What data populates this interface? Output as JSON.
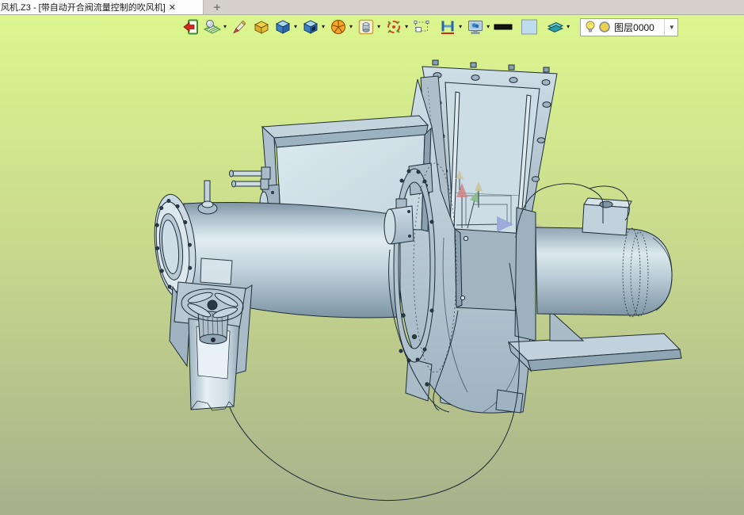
{
  "window": {
    "tab_title": "风机.Z3 - [带自动开合阀流量控制的吹风机]",
    "close_glyph": "✕",
    "new_tab_glyph": "+"
  },
  "toolbar": {
    "dropdown_glyph": "▾",
    "combo_dropdown_glyph": "▼",
    "icons": [
      {
        "name": "exit-icon",
        "dropdown": false
      },
      {
        "name": "datum-plane-icon",
        "dropdown": true
      },
      {
        "name": "sketch-pen-icon",
        "dropdown": false
      },
      {
        "name": "extrude-block-icon",
        "dropdown": false
      },
      {
        "name": "solid-box-icon",
        "dropdown": true
      },
      {
        "name": "box-hole-icon",
        "dropdown": true
      },
      {
        "name": "revolve-sphere-icon",
        "dropdown": true
      },
      {
        "name": "cylinder-frame-icon",
        "dropdown": true
      },
      {
        "name": "point-target-icon",
        "dropdown": true
      },
      {
        "name": "selection-box-icon",
        "dropdown": false
      },
      {
        "name": "dimension-icon",
        "dropdown": true
      },
      {
        "name": "display-mode-icon",
        "dropdown": true
      },
      {
        "name": "line-width-swatch",
        "dropdown": false
      },
      {
        "name": "color-swatch",
        "dropdown": false
      },
      {
        "name": "layers-icon",
        "dropdown": true
      }
    ],
    "layer_combo": {
      "value": "图层0000",
      "bulb_icon": "layer-visibility-bulb",
      "color_icon": "layer-color-circle"
    }
  },
  "viewport": {
    "model_name": "带自动开合阀流量控制的吹风机",
    "background_gradient_top": "#dcf68e",
    "background_gradient_bottom": "#a7b18c",
    "model_fill": "#b9c9d5",
    "model_outline": "#1e2d38",
    "triad_colors": {
      "x": "#cc8484",
      "y": "#86b886",
      "z": "#98a5d8"
    }
  }
}
